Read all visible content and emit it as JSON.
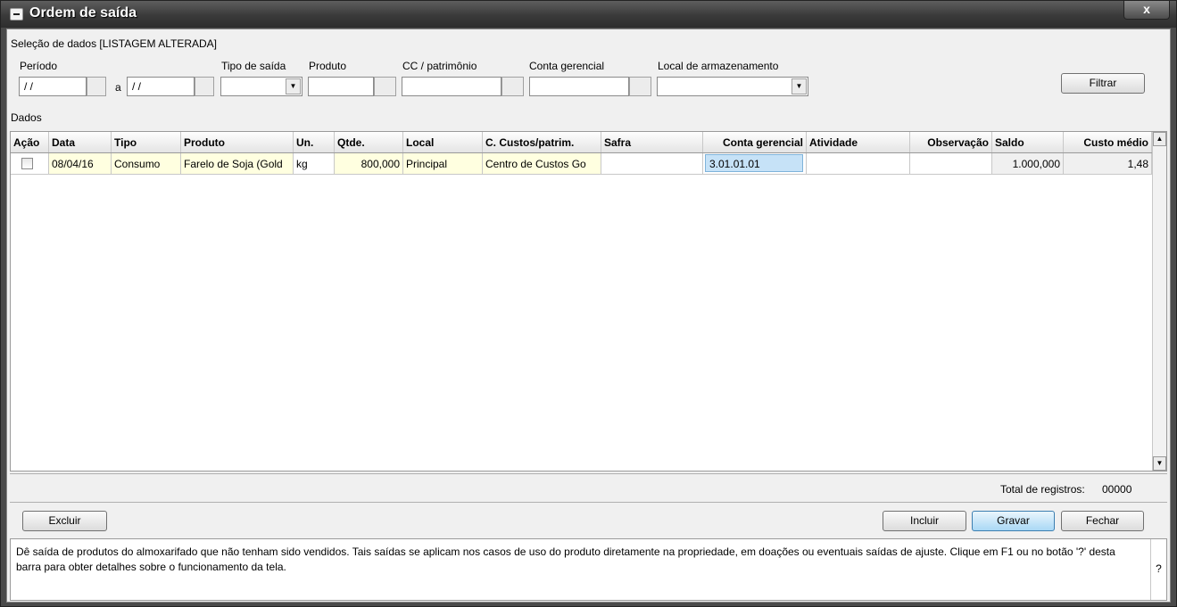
{
  "window": {
    "title": "Ordem de saída",
    "close_label": "x"
  },
  "selection": {
    "title": "Seleção de dados [LISTAGEM ALTERADA]",
    "periodo_label": "Período",
    "periodo_from": "/ /",
    "periodo_sep": "a",
    "periodo_to": "/ /",
    "tipo_saida_label": "Tipo de saída",
    "tipo_saida_value": "",
    "produto_label": "Produto",
    "produto_value": "",
    "cc_label": "CC / patrimônio",
    "cc_value": "",
    "conta_label": "Conta gerencial",
    "conta_value": "",
    "local_label": "Local de armazenamento",
    "local_value": "",
    "filtrar_label": "Filtrar"
  },
  "data_section": {
    "title": "Dados",
    "columns": [
      "Ação",
      "Data",
      "Tipo",
      "Produto",
      "Un.",
      "Qtde.",
      "Local",
      "C. Custos/patrim.",
      "Safra",
      "Conta gerencial",
      "Atividade",
      "Observação",
      "Saldo",
      "Custo médio"
    ],
    "rows": [
      {
        "acao": false,
        "data": "08/04/16",
        "tipo": "Consumo",
        "produto": "Farelo de Soja (Gold",
        "un": "kg",
        "qtde": "800,000",
        "local": "Principal",
        "cc": "Centro de Custos Go",
        "safra": "",
        "conta": "3.01.01.01",
        "atividade": "",
        "observacao": "",
        "saldo": "1.000,000",
        "custo_medio": "1,48"
      }
    ]
  },
  "footer": {
    "total_label": "Total de registros:",
    "total_value": "00000",
    "excluir_label": "Excluir",
    "incluir_label": "Incluir",
    "gravar_label": "Gravar",
    "fechar_label": "Fechar"
  },
  "help": {
    "text": "Dê saída de produtos do almoxarifado que não tenham sido vendidos. Tais saídas se aplicam nos casos de uso do produto diretamente na propriedade, em doações ou eventuais saídas de ajuste. Clique em F1 ou no botão '?' desta barra para obter detalhes sobre o funcionamento da tela.",
    "help_button": "?"
  },
  "icons": {
    "dropdown": "chevron-down-icon",
    "scroll_up": "arrow-up-icon",
    "scroll_down": "arrow-down-icon"
  }
}
